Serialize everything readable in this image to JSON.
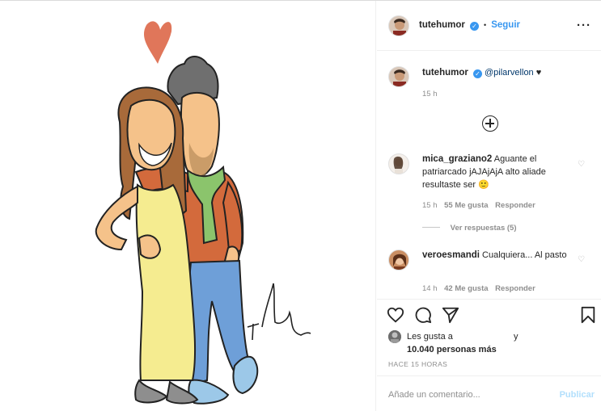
{
  "post": {
    "author": "tutehumor",
    "follow_label": "Seguir",
    "separator": "•",
    "more_label": "···"
  },
  "caption": {
    "author": "tutehumor",
    "mention": "@pilarvellon",
    "heart": "♥",
    "time": "15 h"
  },
  "comments": [
    {
      "user": "mica_graziano2",
      "text": "Aguante el patriarcado jAJAjAjA alto aliade resultaste ser 🙂",
      "time": "15 h",
      "likes": "55 Me gusta",
      "reply": "Responder",
      "replies": "Ver respuestas (5)"
    },
    {
      "user": "veroesmandi",
      "text": "Cualquiera... Al pasto",
      "time": "14 h",
      "likes": "42 Me gusta",
      "reply": "Responder"
    }
  ],
  "likes": {
    "prefix": "Les gusta a",
    "and": "y",
    "count": "10.040 personas más"
  },
  "timestamp": "HACE 15 HORAS",
  "add_comment": {
    "placeholder": "Añade un comentario...",
    "publish": "Publicar"
  },
  "colors": {
    "accent": "#3897f0",
    "publish_disabled": "#b2dffc",
    "secondary_text": "#8e8e8e"
  },
  "icons": [
    "heart-icon",
    "comment-icon",
    "share-icon",
    "bookmark-icon",
    "verified-icon",
    "plus-circle-icon",
    "more-icon"
  ]
}
